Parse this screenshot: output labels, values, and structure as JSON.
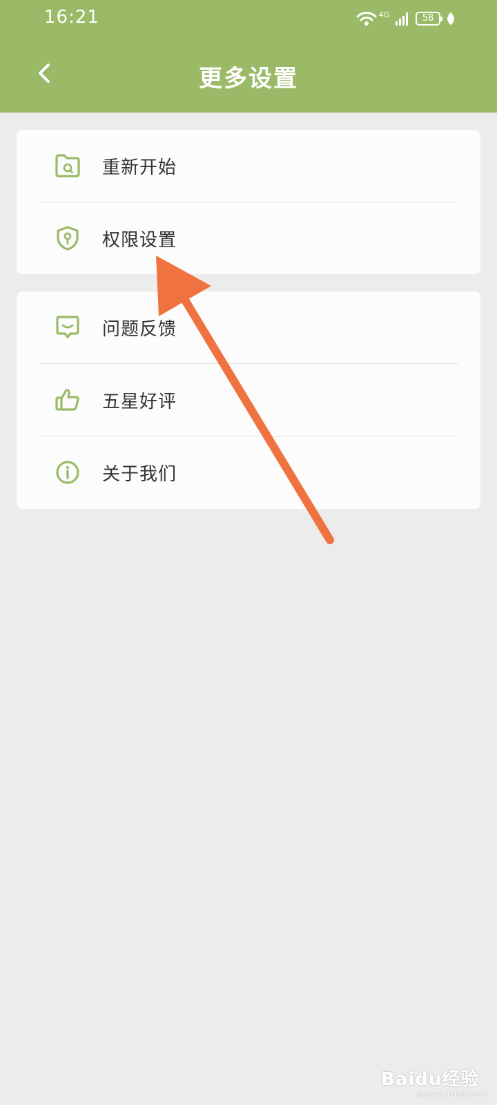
{
  "status_bar": {
    "time": "16:21",
    "network": "4G",
    "battery": "58",
    "icons": [
      "wifi-icon",
      "signal-icon",
      "battery-icon",
      "leaf-icon"
    ]
  },
  "header": {
    "back_icon": "chevron-left-icon",
    "title": "更多设置"
  },
  "groups": [
    {
      "items": [
        {
          "label": "重新开始",
          "icon": "folder-refresh-icon"
        },
        {
          "label": "权限设置",
          "icon": "shield-key-icon"
        }
      ]
    },
    {
      "items": [
        {
          "label": "问题反馈",
          "icon": "feedback-message-icon"
        },
        {
          "label": "五星好评",
          "icon": "thumbs-up-icon"
        },
        {
          "label": "关于我们",
          "icon": "info-icon"
        }
      ]
    }
  ],
  "watermark": {
    "brand": "Baidu经验",
    "url": "jingyan.baidu.com"
  },
  "colors": {
    "header_bg": "#9aba67",
    "icon_green": "#9aba67",
    "page_bg": "#ececec",
    "annotation_arrow": "#f07240"
  }
}
